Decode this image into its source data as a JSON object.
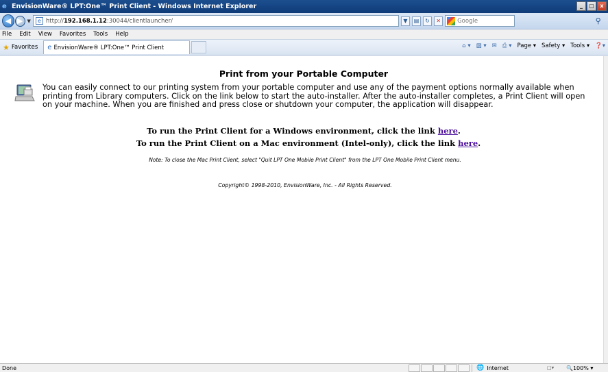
{
  "window": {
    "title": "EnvisionWare® LPT:One™ Print Client - Windows Internet Explorer",
    "buttons": [
      "_",
      "▢",
      "x"
    ]
  },
  "address_bar": {
    "url_prefix": "http://",
    "url_host": "192.168.1.12",
    "url_rest": ":30044/clientlauncher/",
    "search_placeholder": "Google"
  },
  "menu": [
    "File",
    "Edit",
    "View",
    "Favorites",
    "Tools",
    "Help"
  ],
  "favorites_bar": {
    "favorites_label": "Favorites",
    "tab_title": "EnvisionWare® LPT:One™ Print Client"
  },
  "command_bar": {
    "page": "Page ▾",
    "safety": "Safety ▾",
    "tools": "Tools ▾"
  },
  "page": {
    "heading": "Print from your Portable Computer",
    "intro": "You can easily connect to our printing system from your portable computer and use any of the payment options normally available when printing from Library computers.  Click on the link below to start the auto-installer.  After the auto-installer completes, a Print Client will open on your machine.  When you are finished and press close or shutdown your computer, the application will disappear.",
    "windows_text": "To run the Print Client for a Windows environment, click the link ",
    "windows_link": "here",
    "mac_text": "To run the Print Client on a Mac environment (Intel-only), click the link ",
    "mac_link": "here",
    "period": ".",
    "note": "Note: To close the Mac Print Client, select \"Quit LPT One Mobile Print Client\" from the LPT One Mobile Print Client menu.",
    "copyright": "Copyright© 1998-2010, EnvisionWare, Inc. - All Rights Reserved."
  },
  "status_bar": {
    "status": "Done",
    "zone": "Internet",
    "zoom": "100%"
  }
}
